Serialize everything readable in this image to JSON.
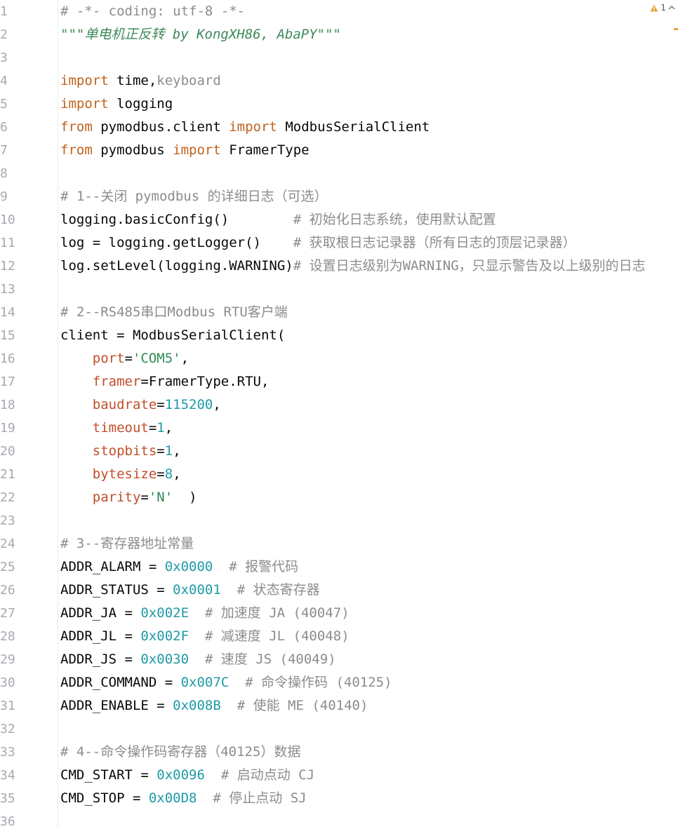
{
  "editor": {
    "inspection": {
      "warning_count": "1",
      "icon": "warning-triangle-icon",
      "nav_icon": "chevron-up-icon"
    },
    "colors": {
      "keyword": "#c2611a",
      "comment": "#8c8c8c",
      "docstring": "#3d8a5c",
      "parameter": "#c24e2a",
      "number": "#1f9aa6",
      "string": "#2e8b57",
      "text": "#080808"
    },
    "lines": [
      {
        "n": "1",
        "tokens": [
          {
            "t": "# -*- coding: utf-8 -*-",
            "c": "com"
          }
        ]
      },
      {
        "n": "2",
        "tokens": [
          {
            "t": "\"\"\"单电机正反转 by KongXH86, AbaPY\"\"\"",
            "c": "doc"
          }
        ]
      },
      {
        "n": "3",
        "tokens": []
      },
      {
        "n": "4",
        "tokens": [
          {
            "t": "import",
            "c": "kw"
          },
          {
            "t": " time,",
            "c": "plain"
          },
          {
            "t": "keyboard",
            "c": "dim"
          }
        ]
      },
      {
        "n": "5",
        "tokens": [
          {
            "t": "import",
            "c": "kw"
          },
          {
            "t": " logging",
            "c": "plain"
          }
        ]
      },
      {
        "n": "6",
        "tokens": [
          {
            "t": "from",
            "c": "kw"
          },
          {
            "t": " pymodbus.client ",
            "c": "plain"
          },
          {
            "t": "import",
            "c": "kw"
          },
          {
            "t": " ModbusSerialClient",
            "c": "plain"
          }
        ]
      },
      {
        "n": "7",
        "tokens": [
          {
            "t": "from",
            "c": "kw"
          },
          {
            "t": " pymodbus ",
            "c": "plain"
          },
          {
            "t": "import",
            "c": "kw"
          },
          {
            "t": " FramerType",
            "c": "plain"
          }
        ]
      },
      {
        "n": "8",
        "tokens": []
      },
      {
        "n": "9",
        "tokens": [
          {
            "t": "# 1--关闭 pymodbus 的详细日志（可选）",
            "c": "com"
          }
        ]
      },
      {
        "n": "10",
        "tokens": [
          {
            "t": "logging.basicConfig()        ",
            "c": "plain"
          },
          {
            "t": "# 初始化日志系统，使用默认配置",
            "c": "com"
          }
        ]
      },
      {
        "n": "11",
        "tokens": [
          {
            "t": "log = logging.getLogger()    ",
            "c": "plain"
          },
          {
            "t": "# 获取根日志记录器（所有日志的顶层记录器）",
            "c": "com"
          }
        ]
      },
      {
        "n": "12",
        "tokens": [
          {
            "t": "log.setLevel(logging.WARNING)",
            "c": "plain"
          },
          {
            "t": "# 设置日志级别为WARNING，只显示警告及以上级别的日志",
            "c": "com"
          }
        ]
      },
      {
        "n": "13",
        "tokens": []
      },
      {
        "n": "14",
        "tokens": [
          {
            "t": "# 2--RS485串口Modbus RTU客户端",
            "c": "com"
          }
        ]
      },
      {
        "n": "15",
        "tokens": [
          {
            "t": "client = ModbusSerialClient(",
            "c": "plain"
          }
        ]
      },
      {
        "n": "16",
        "tokens": [
          {
            "t": "    ",
            "c": "plain"
          },
          {
            "t": "port",
            "c": "param"
          },
          {
            "t": "=",
            "c": "plain"
          },
          {
            "t": "'COM5'",
            "c": "str"
          },
          {
            "t": ",",
            "c": "plain"
          }
        ]
      },
      {
        "n": "17",
        "tokens": [
          {
            "t": "    ",
            "c": "plain"
          },
          {
            "t": "framer",
            "c": "param"
          },
          {
            "t": "=FramerType.RTU,",
            "c": "plain"
          }
        ]
      },
      {
        "n": "18",
        "tokens": [
          {
            "t": "    ",
            "c": "plain"
          },
          {
            "t": "baudrate",
            "c": "param"
          },
          {
            "t": "=",
            "c": "plain"
          },
          {
            "t": "115200",
            "c": "num"
          },
          {
            "t": ",",
            "c": "plain"
          }
        ]
      },
      {
        "n": "19",
        "tokens": [
          {
            "t": "    ",
            "c": "plain"
          },
          {
            "t": "timeout",
            "c": "param"
          },
          {
            "t": "=",
            "c": "plain"
          },
          {
            "t": "1",
            "c": "num"
          },
          {
            "t": ",",
            "c": "plain"
          }
        ]
      },
      {
        "n": "20",
        "tokens": [
          {
            "t": "    ",
            "c": "plain"
          },
          {
            "t": "stopbits",
            "c": "param"
          },
          {
            "t": "=",
            "c": "plain"
          },
          {
            "t": "1",
            "c": "num"
          },
          {
            "t": ",",
            "c": "plain"
          }
        ]
      },
      {
        "n": "21",
        "tokens": [
          {
            "t": "    ",
            "c": "plain"
          },
          {
            "t": "bytesize",
            "c": "param"
          },
          {
            "t": "=",
            "c": "plain"
          },
          {
            "t": "8",
            "c": "num"
          },
          {
            "t": ",",
            "c": "plain"
          }
        ]
      },
      {
        "n": "22",
        "tokens": [
          {
            "t": "    ",
            "c": "plain"
          },
          {
            "t": "parity",
            "c": "param"
          },
          {
            "t": "=",
            "c": "plain"
          },
          {
            "t": "'N'",
            "c": "str"
          },
          {
            "t": "  )",
            "c": "plain"
          }
        ]
      },
      {
        "n": "23",
        "tokens": []
      },
      {
        "n": "24",
        "tokens": [
          {
            "t": "# 3--寄存器地址常量",
            "c": "com"
          }
        ]
      },
      {
        "n": "25",
        "tokens": [
          {
            "t": "ADDR_ALARM = ",
            "c": "plain"
          },
          {
            "t": "0x0000",
            "c": "num"
          },
          {
            "t": "  ",
            "c": "plain"
          },
          {
            "t": "# 报警代码",
            "c": "com"
          }
        ]
      },
      {
        "n": "26",
        "tokens": [
          {
            "t": "ADDR_STATUS = ",
            "c": "plain"
          },
          {
            "t": "0x0001",
            "c": "num"
          },
          {
            "t": "  ",
            "c": "plain"
          },
          {
            "t": "# 状态寄存器",
            "c": "com"
          }
        ]
      },
      {
        "n": "27",
        "tokens": [
          {
            "t": "ADDR_JA = ",
            "c": "plain"
          },
          {
            "t": "0x002E",
            "c": "num"
          },
          {
            "t": "  ",
            "c": "plain"
          },
          {
            "t": "# 加速度 JA (40047)",
            "c": "com"
          }
        ]
      },
      {
        "n": "28",
        "tokens": [
          {
            "t": "ADDR_JL = ",
            "c": "plain"
          },
          {
            "t": "0x002F",
            "c": "num"
          },
          {
            "t": "  ",
            "c": "plain"
          },
          {
            "t": "# 减速度 JL (40048)",
            "c": "com"
          }
        ]
      },
      {
        "n": "29",
        "tokens": [
          {
            "t": "ADDR_JS = ",
            "c": "plain"
          },
          {
            "t": "0x0030",
            "c": "num"
          },
          {
            "t": "  ",
            "c": "plain"
          },
          {
            "t": "# 速度 JS (40049)",
            "c": "com"
          }
        ]
      },
      {
        "n": "30",
        "tokens": [
          {
            "t": "ADDR_COMMAND = ",
            "c": "plain"
          },
          {
            "t": "0x007C",
            "c": "num"
          },
          {
            "t": "  ",
            "c": "plain"
          },
          {
            "t": "# 命令操作码 (40125)",
            "c": "com"
          }
        ]
      },
      {
        "n": "31",
        "tokens": [
          {
            "t": "ADDR_ENABLE = ",
            "c": "plain"
          },
          {
            "t": "0x008B",
            "c": "num"
          },
          {
            "t": "  ",
            "c": "plain"
          },
          {
            "t": "# 使能 ME (40140)",
            "c": "com"
          }
        ]
      },
      {
        "n": "32",
        "tokens": []
      },
      {
        "n": "33",
        "tokens": [
          {
            "t": "# 4--命令操作码寄存器（40125）数据",
            "c": "com"
          }
        ]
      },
      {
        "n": "34",
        "tokens": [
          {
            "t": "CMD_START = ",
            "c": "plain"
          },
          {
            "t": "0x0096",
            "c": "num"
          },
          {
            "t": "  ",
            "c": "plain"
          },
          {
            "t": "# 启动点动 CJ",
            "c": "com"
          }
        ]
      },
      {
        "n": "35",
        "tokens": [
          {
            "t": "CMD_STOP = ",
            "c": "plain"
          },
          {
            "t": "0x00D8",
            "c": "num"
          },
          {
            "t": "  ",
            "c": "plain"
          },
          {
            "t": "# 停止点动 SJ",
            "c": "com"
          }
        ]
      },
      {
        "n": "36",
        "tokens": []
      }
    ]
  }
}
